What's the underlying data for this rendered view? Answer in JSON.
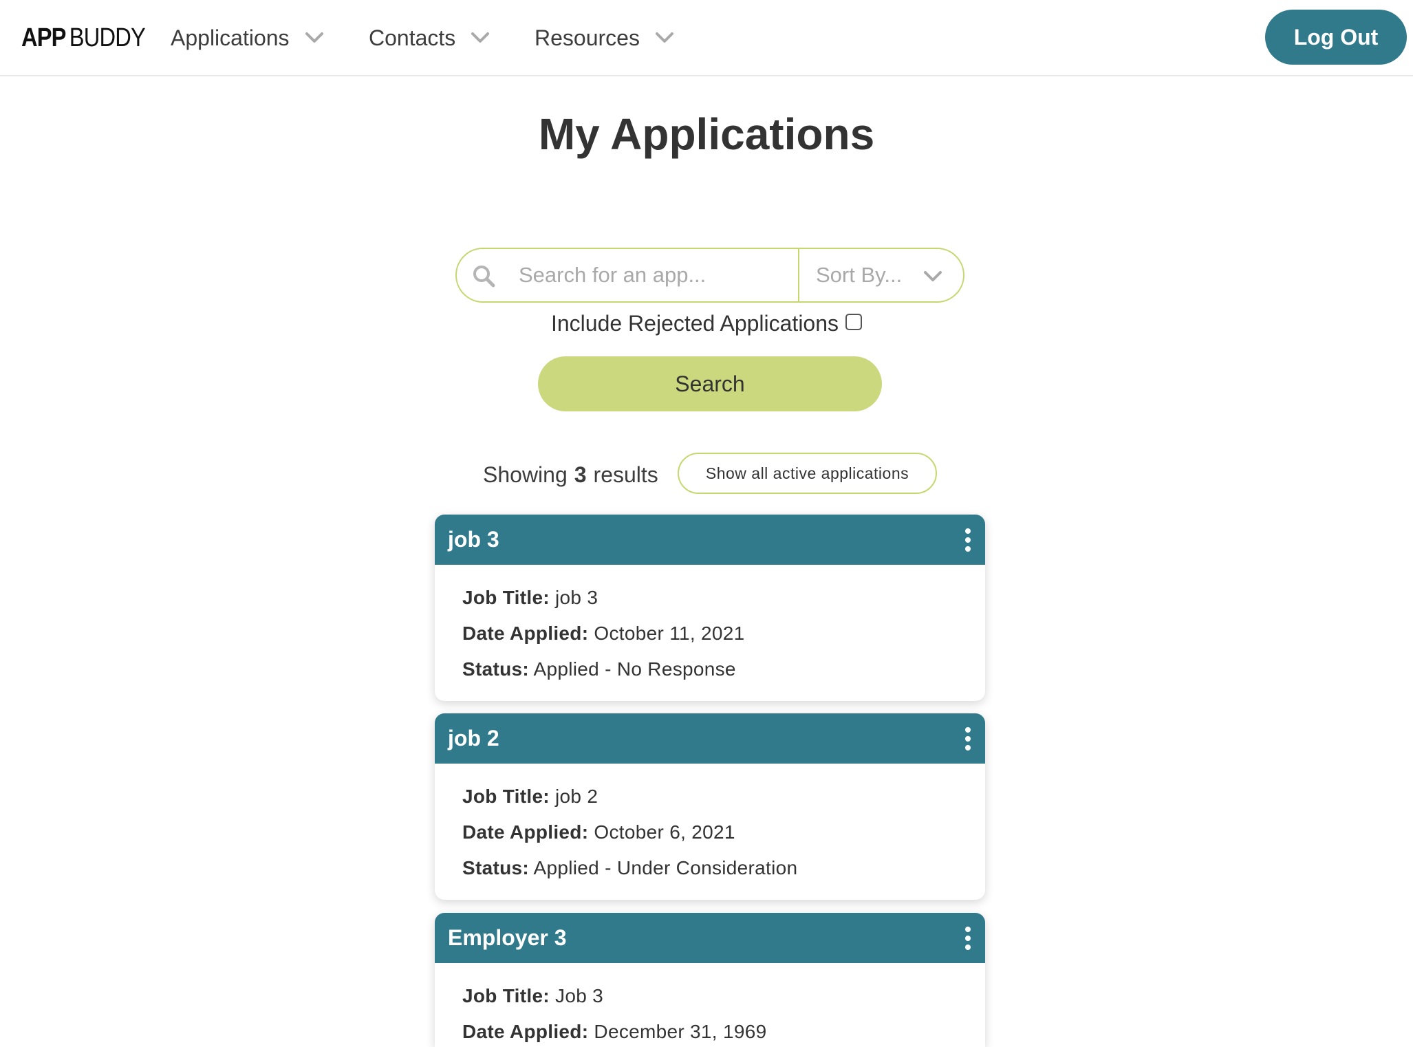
{
  "brand": {
    "bold": "APP",
    "light": "BUDDY"
  },
  "nav": [
    {
      "label": "Applications"
    },
    {
      "label": "Contacts"
    },
    {
      "label": "Resources"
    }
  ],
  "logout_label": "Log Out",
  "page_title": "My Applications",
  "search": {
    "placeholder": "Search for an app...",
    "value": "",
    "sort_placeholder": "Sort By..."
  },
  "include_rejected": {
    "label": "Include Rejected Applications",
    "checked": false
  },
  "search_button": "Search",
  "results": {
    "prefix": "Showing",
    "count": "3",
    "suffix": "results",
    "show_all_label": "Show all active applications"
  },
  "field_labels": {
    "job_title": "Job Title:",
    "date_applied": "Date Applied:",
    "status": "Status:"
  },
  "applications": [
    {
      "employer": "job 3",
      "job_title": "job 3",
      "date_applied": "October 11, 2021",
      "status": "Applied - No Response"
    },
    {
      "employer": "job 2",
      "job_title": "job 2",
      "date_applied": "October 6, 2021",
      "status": "Applied - Under Consideration"
    },
    {
      "employer": "Employer 3",
      "job_title": "Job 3",
      "date_applied": "December 31, 1969",
      "status": ""
    }
  ],
  "colors": {
    "primary": "#317a8c",
    "accent": "#cbd87d",
    "accent_border": "#c5d870"
  }
}
